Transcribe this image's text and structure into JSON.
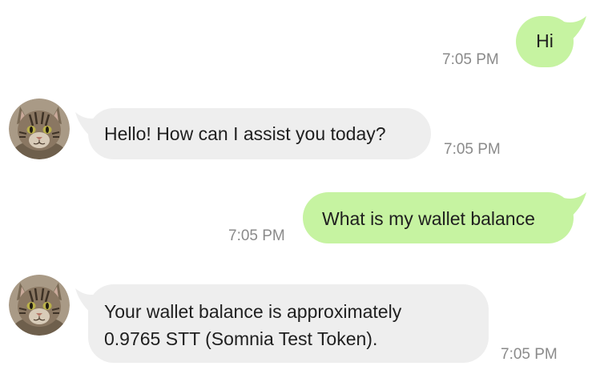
{
  "messages": [
    {
      "sender": "user",
      "text": "Hi",
      "time": "7:05 PM"
    },
    {
      "sender": "bot",
      "text": "Hello! How can I assist you today?",
      "time": "7:05 PM",
      "avatar": "cat-avatar"
    },
    {
      "sender": "user",
      "text": "What is my wallet balance",
      "time": "7:05 PM"
    },
    {
      "sender": "bot",
      "lines": [
        "Your wallet balance is approximately",
        "0.9765 STT (Somnia Test Token)."
      ],
      "time": "7:05 PM",
      "avatar": "cat-avatar"
    }
  ],
  "colors": {
    "outgoing_bubble": "#c6f3a1",
    "incoming_bubble": "#eeeeee",
    "timestamp": "#8a8a8a"
  }
}
